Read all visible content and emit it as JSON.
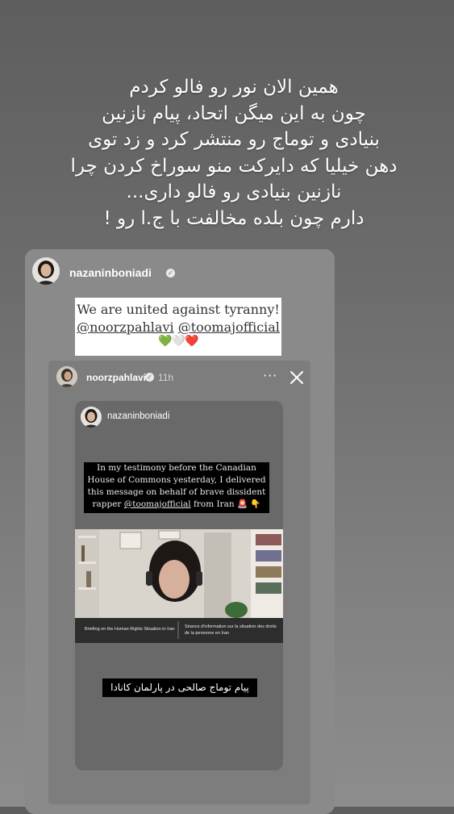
{
  "story_caption": {
    "lines": [
      "همین الان نور رو فالو کردم",
      "چون به این میگن اتحاد، پیام نازنین",
      "بنیادی و توماج رو منتشر کرد و زد توی",
      "دهن خیلیا که دایرکت منو سوراخ کردن چرا",
      "نازنین بنیادی رو فالو داری...",
      "دارم چون بلده مخالفت با ج.ا رو !"
    ]
  },
  "outer_post": {
    "username": "nazaninboniadi",
    "verified_icon": "verified-badge-icon",
    "sticker": {
      "line1": "We are united against tyranny!",
      "mention1": "@noorzpahlavi",
      "mention2": "@toomajofficial",
      "hearts": "💚🤍❤️"
    }
  },
  "reshared_story": {
    "username": "noorzpahlavi",
    "time": "11h",
    "more_label": "···",
    "inner_post": {
      "username": "nazaninboniadi",
      "testimony_lines": [
        "In my testimony before the Canadian",
        "House of Commons yesterday, I delivered",
        "this message on behalf of brave dissident"
      ],
      "testimony_last_prefix": "rapper ",
      "testimony_mention": "@toomajofficial",
      "testimony_last_suffix": " from Iran 🚨 👇",
      "video": {
        "caption_en": "Briefing on the Human Rights Situation in Iran",
        "caption_fr_line1": "Séance d'information sur la situation des droits",
        "caption_fr_line2": "de la personne en Iran"
      },
      "subtitle": "پیام توماج صالحی در پارلمان کانادا"
    }
  },
  "colors": {
    "background_top": "#5e5e5e",
    "background_bottom": "#8d8d8d",
    "card": "#8a8a8a",
    "inner_card": "#696969"
  }
}
